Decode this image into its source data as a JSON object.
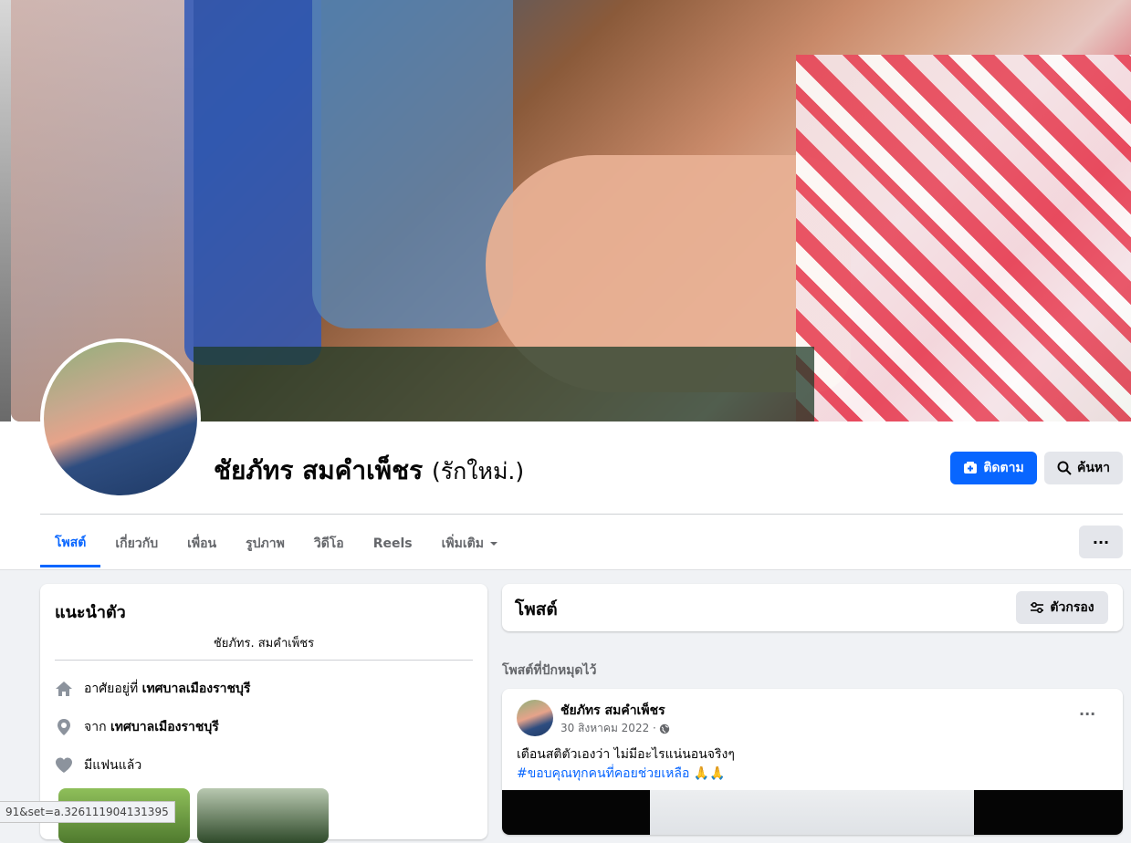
{
  "profile": {
    "name": "ชัยภัทร สมคำเพ็ชร",
    "alternate_name": "(รักใหม่.)"
  },
  "actions": {
    "follow_label": "ติดตาม",
    "search_label": "ค้นหา",
    "more_label": "···"
  },
  "tabs": [
    {
      "label": "โพสต์",
      "active": true
    },
    {
      "label": "เกี่ยวกับ"
    },
    {
      "label": "เพื่อน"
    },
    {
      "label": "รูปภาพ"
    },
    {
      "label": "วิดีโอ"
    },
    {
      "label": "Reels"
    },
    {
      "label": "เพิ่มเติม"
    }
  ],
  "intro": {
    "title": "แนะนำตัว",
    "bio": "ชัยภัทร. สมคำเพ็ชร",
    "lives_prefix": "อาศัยอยู่ที่",
    "lives_place": "เทศบาลเมืองราชบุรี",
    "from_prefix": "จาก",
    "from_place": "เทศบาลเมืองราชบุรี",
    "relationship": "มีแฟนแล้ว"
  },
  "posts": {
    "title": "โพสต์",
    "filter_label": "ตัวกรอง",
    "pinned_label": "โพสต์ที่ปักหมุดไว้"
  },
  "post": {
    "author": "ชัยภัทร สมคำเพ็ชร",
    "date": "30 สิงหาคม 2022 ·",
    "text": "เตือนสติตัวเองว่า ไม่มีอะไรแน่นอนจริงๆ",
    "hashtag": "#ขอบคุณทุกคนที่คอยช่วยเหลือ 🙏🙏",
    "more": "···"
  },
  "status_url": "91&set=a.326111904131395",
  "colors": {
    "accent": "#0866ff",
    "background": "#f0f2f5",
    "secondary_text": "#65676b"
  }
}
